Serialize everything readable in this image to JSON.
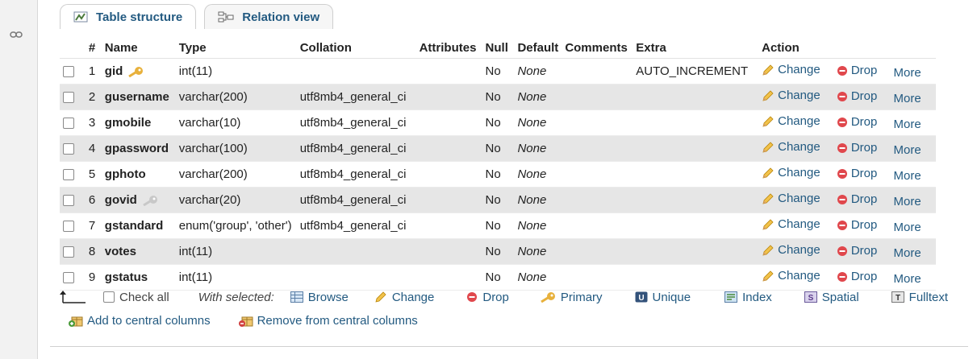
{
  "tabs": [
    {
      "label": "Table structure",
      "icon": "table-structure-icon",
      "active": true
    },
    {
      "label": "Relation view",
      "icon": "relation-view-icon",
      "active": false
    }
  ],
  "table": {
    "headers": {
      "num": "#",
      "name": "Name",
      "type": "Type",
      "collation": "Collation",
      "attributes": "Attributes",
      "null": "Null",
      "default": "Default",
      "comments": "Comments",
      "extra": "Extra",
      "action": "Action"
    },
    "rows": [
      {
        "num": "1",
        "name": "gid",
        "key": "primary",
        "type": "int(11)",
        "collation": "",
        "attributes": "",
        "null": "No",
        "default": "None",
        "comments": "",
        "extra": "AUTO_INCREMENT"
      },
      {
        "num": "2",
        "name": "gusername",
        "key": "",
        "type": "varchar(200)",
        "collation": "utf8mb4_general_ci",
        "attributes": "",
        "null": "No",
        "default": "None",
        "comments": "",
        "extra": ""
      },
      {
        "num": "3",
        "name": "gmobile",
        "key": "",
        "type": "varchar(10)",
        "collation": "utf8mb4_general_ci",
        "attributes": "",
        "null": "No",
        "default": "None",
        "comments": "",
        "extra": ""
      },
      {
        "num": "4",
        "name": "gpassword",
        "key": "",
        "type": "varchar(100)",
        "collation": "utf8mb4_general_ci",
        "attributes": "",
        "null": "No",
        "default": "None",
        "comments": "",
        "extra": ""
      },
      {
        "num": "5",
        "name": "gphoto",
        "key": "",
        "type": "varchar(200)",
        "collation": "utf8mb4_general_ci",
        "attributes": "",
        "null": "No",
        "default": "None",
        "comments": "",
        "extra": ""
      },
      {
        "num": "6",
        "name": "govid",
        "key": "unique",
        "type": "varchar(20)",
        "collation": "utf8mb4_general_ci",
        "attributes": "",
        "null": "No",
        "default": "None",
        "comments": "",
        "extra": ""
      },
      {
        "num": "7",
        "name": "gstandard",
        "key": "",
        "type": "enum('group', 'other')",
        "collation": "utf8mb4_general_ci",
        "attributes": "",
        "null": "No",
        "default": "None",
        "comments": "",
        "extra": ""
      },
      {
        "num": "8",
        "name": "votes",
        "key": "",
        "type": "int(11)",
        "collation": "",
        "attributes": "",
        "null": "No",
        "default": "None",
        "comments": "",
        "extra": ""
      },
      {
        "num": "9",
        "name": "gstatus",
        "key": "",
        "type": "int(11)",
        "collation": "",
        "attributes": "",
        "null": "No",
        "default": "None",
        "comments": "",
        "extra": ""
      }
    ],
    "actions": {
      "change": "Change",
      "drop": "Drop",
      "more": "More"
    }
  },
  "bulk": {
    "check_all": "Check all",
    "with_selected": "With selected:",
    "browse": "Browse",
    "change": "Change",
    "drop": "Drop",
    "primary": "Primary",
    "unique": "Unique",
    "index": "Index",
    "spatial": "Spatial",
    "fulltext": "Fulltext"
  },
  "central": {
    "add": "Add to central columns",
    "remove": "Remove from central columns"
  },
  "colors": {
    "link": "#235a81",
    "row_alt": "#e6e6e6",
    "key_gold": "#e8b13c",
    "drop_red": "#e0474c"
  }
}
